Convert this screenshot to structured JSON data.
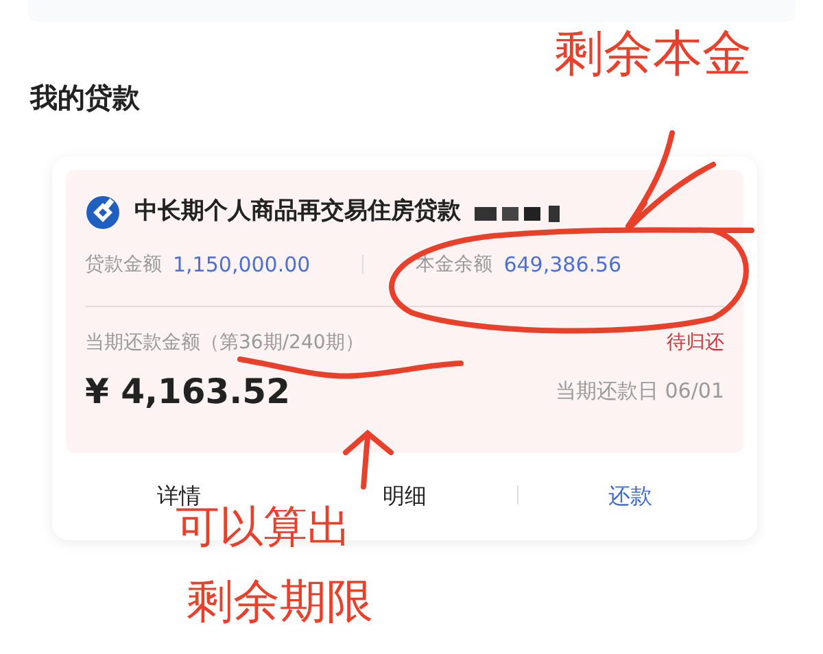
{
  "section_title": "我的贷款",
  "loan": {
    "name": "中长期个人商品再交易住房贷款",
    "summary": [
      {
        "label": "贷款金额",
        "value": "1,150,000.00"
      },
      {
        "label": "本金余额",
        "value": "649,386.56"
      }
    ],
    "installment_label": "当期还款金额（第36期/240期）",
    "status": "待归还",
    "amount": "¥ 4,163.52",
    "due_label": "当期还款日 06/01"
  },
  "actions": [
    {
      "label": "详情",
      "kind": "plain"
    },
    {
      "label": "明细",
      "kind": "plain"
    },
    {
      "label": "还款",
      "kind": "primary"
    }
  ],
  "annotations": [
    "剩余本金",
    "可以算出",
    "剩余期限"
  ]
}
